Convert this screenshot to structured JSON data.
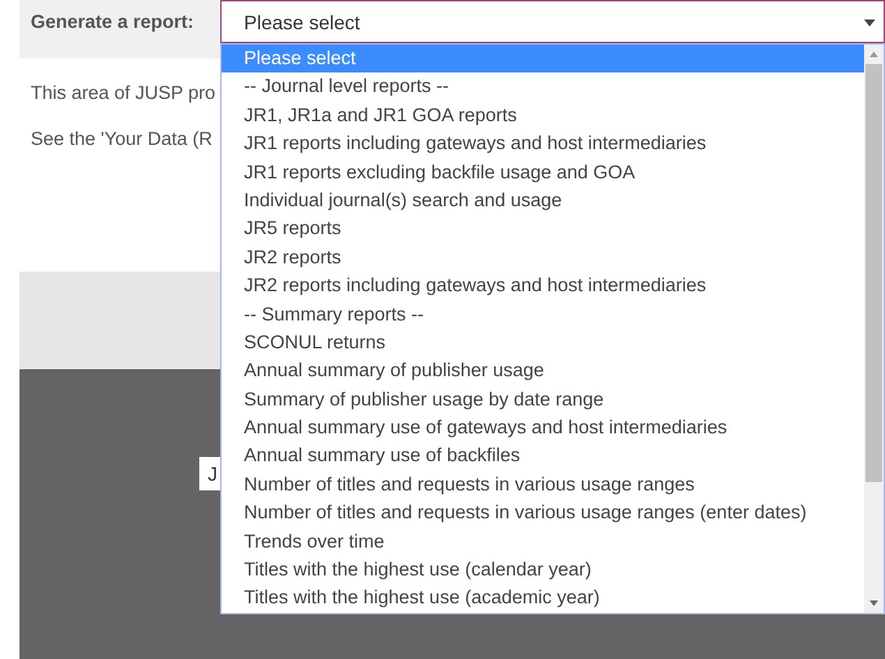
{
  "report_bar": {
    "label": "Generate a report:",
    "select": {
      "value": "Please select",
      "expanded": true
    }
  },
  "intro_lines": [
    "This area of JUSP pro",
    "See the 'Your Data (R"
  ],
  "footer_button": {
    "label": "J"
  },
  "options": [
    {
      "label": "Please select",
      "selected": true
    },
    {
      "label": "-- Journal level reports --",
      "selected": false
    },
    {
      "label": "JR1, JR1a and JR1 GOA reports",
      "selected": false
    },
    {
      "label": "JR1 reports including gateways and host intermediaries",
      "selected": false
    },
    {
      "label": "JR1 reports excluding backfile usage and GOA",
      "selected": false
    },
    {
      "label": "Individual journal(s) search and usage",
      "selected": false
    },
    {
      "label": "JR5 reports",
      "selected": false
    },
    {
      "label": "JR2 reports",
      "selected": false
    },
    {
      "label": "JR2 reports including gateways and host intermediaries",
      "selected": false
    },
    {
      "label": "-- Summary reports --",
      "selected": false
    },
    {
      "label": "SCONUL returns",
      "selected": false
    },
    {
      "label": "Annual summary of publisher usage",
      "selected": false
    },
    {
      "label": "Summary of publisher usage by date range",
      "selected": false
    },
    {
      "label": "Annual summary use of gateways and host intermediaries",
      "selected": false
    },
    {
      "label": "Annual summary use of backfiles",
      "selected": false
    },
    {
      "label": "Number of titles and requests in various usage ranges",
      "selected": false
    },
    {
      "label": "Number of titles and requests in various usage ranges (enter dates)",
      "selected": false
    },
    {
      "label": "Trends over time",
      "selected": false
    },
    {
      "label": "Titles with the highest use (calendar year)",
      "selected": false
    },
    {
      "label": "Titles with the highest use (academic year)",
      "selected": false
    }
  ]
}
